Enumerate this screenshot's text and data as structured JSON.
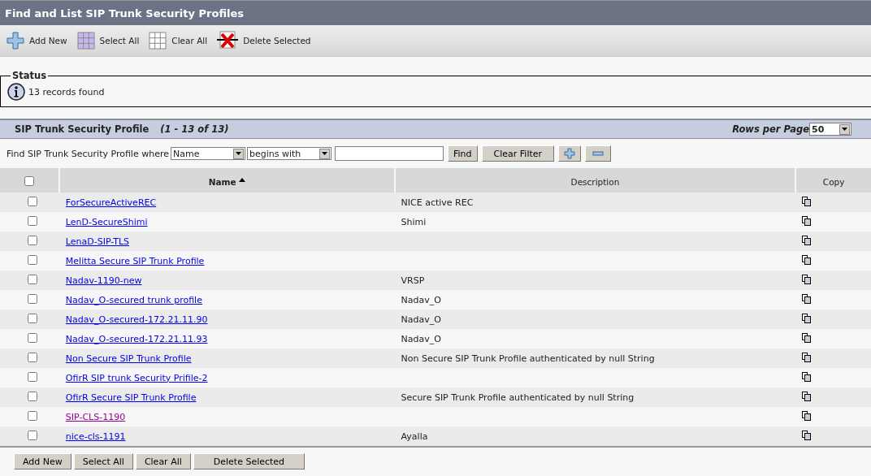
{
  "window": {
    "title": "Find and List SIP Trunk Security Profiles"
  },
  "toolbar": [
    {
      "kind": "add",
      "label": "Add New"
    },
    {
      "kind": "select",
      "label": "Select All"
    },
    {
      "kind": "clear",
      "label": "Clear All"
    },
    {
      "kind": "delete",
      "label": "Delete Selected"
    }
  ],
  "status": {
    "legend": "Status",
    "message": "13 records found"
  },
  "section": {
    "title": "SIP Trunk Security Profile",
    "range": "(1 - 13 of 13)",
    "rows_per_page_label": "Rows per Page",
    "rows_per_page": "50"
  },
  "filter": {
    "label": "Find SIP Trunk Security Profile where",
    "field": "Name",
    "operator": "begins with",
    "find": "Find",
    "clear": "Clear Filter"
  },
  "table": {
    "columns": [
      {
        "label": "Name",
        "sorted": true
      },
      {
        "label": "Description",
        "sorted": false
      },
      {
        "label": "Copy",
        "sorted": false
      }
    ],
    "select_all_checked": false,
    "rows": [
      {
        "name": "ForSecureActiveREC",
        "description": "NICE active REC",
        "checked": false,
        "visited": false
      },
      {
        "name": "LenD-SecureShimi",
        "description": "Shimi",
        "checked": false,
        "visited": false
      },
      {
        "name": "LenaD-SIP-TLS",
        "checked": false,
        "visited": false
      },
      {
        "name": "Melitta Secure SIP Trunk Profile",
        "checked": false,
        "visited": false
      },
      {
        "name": "Nadav-1190-new",
        "description": "VRSP",
        "checked": false,
        "visited": false
      },
      {
        "name": "Nadav_O-secured trunk profile",
        "description": "Nadav_O",
        "checked": false,
        "visited": false
      },
      {
        "name": "Nadav_O-secured-172.21.11.90",
        "description": "Nadav_O",
        "checked": false,
        "visited": false
      },
      {
        "name": "Nadav_O-secured-172.21.11.93",
        "description": "Nadav_O",
        "checked": false,
        "visited": false
      },
      {
        "name": "Non Secure SIP Trunk Profile",
        "description": "Non Secure SIP Trunk Profile authenticated by null String",
        "checked": false,
        "visited": false
      },
      {
        "name": "OfirR SIP trunk Security Prifile-2",
        "checked": false,
        "visited": false
      },
      {
        "name": "OfirR Secure SIP Trunk Profile",
        "description": "Secure SIP Trunk Profile authenticated by null String",
        "checked": false,
        "visited": false
      },
      {
        "name": "SIP-CLS-1190",
        "checked": false,
        "visited": true
      },
      {
        "name": "nice-cls-1191",
        "description": "Ayalla",
        "checked": false,
        "visited": false
      }
    ]
  },
  "bottom_buttons": [
    "Add New",
    "Select All",
    "Clear All",
    "Delete Selected"
  ]
}
